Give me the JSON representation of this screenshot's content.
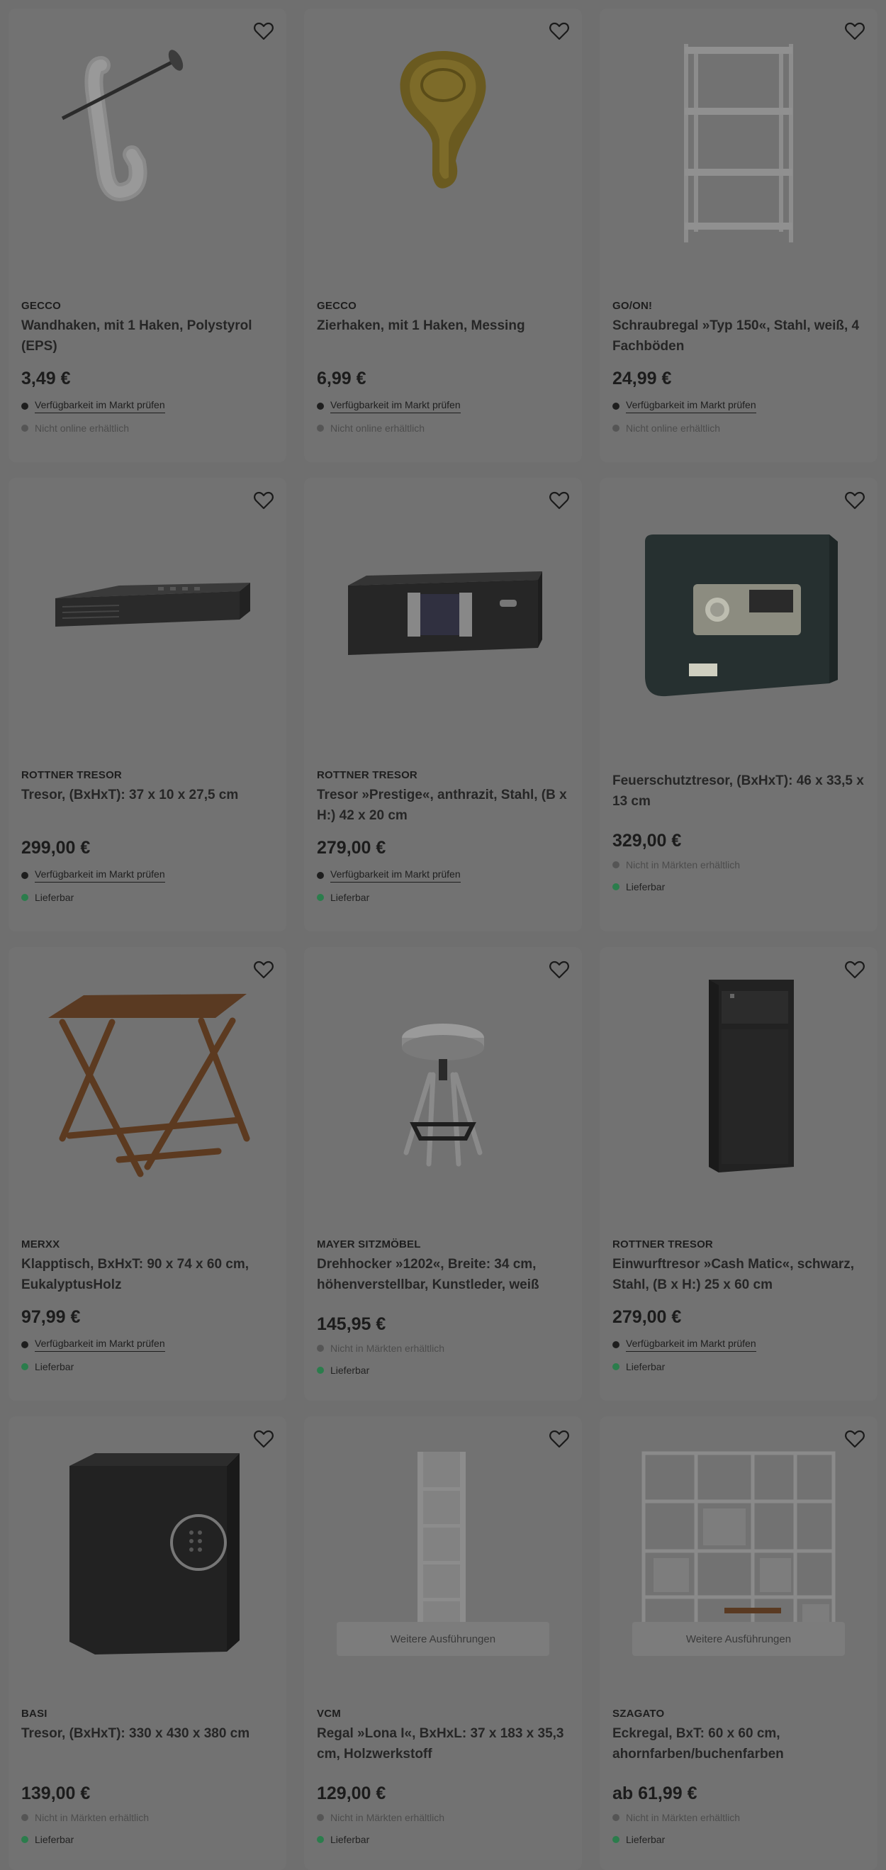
{
  "colors": {
    "page_bg": "#6f6f6f",
    "card_bg": "#727272",
    "dot_store": "#1e1e1e",
    "dot_unavailable": "#555555",
    "dot_deliverable": "#2b7d4c"
  },
  "products": [
    {
      "brand": "GECCO",
      "title": "Wandhaken, mit 1 Haken, Polystyrol (EPS)",
      "price": "3,49 €",
      "image": "clear-wall-hook",
      "store": "Verfügbarkeit im Markt prüfen",
      "store_status": "link",
      "delivery": "Nicht online erhältlich",
      "delivery_status": "unavailable"
    },
    {
      "brand": "GECCO",
      "title": "Zierhaken, mit 1 Haken, Messing",
      "price": "6,99 €",
      "image": "brass-hook",
      "store": "Verfügbarkeit im Markt prüfen",
      "store_status": "link",
      "delivery": "Nicht online erhältlich",
      "delivery_status": "unavailable"
    },
    {
      "brand": "GO/ON!",
      "title": "Schraubregal »Typ 150«, Stahl, weiß, 4 Fachböden",
      "price": "24,99 €",
      "image": "white-steel-shelf",
      "store": "Verfügbarkeit im Markt prüfen",
      "store_status": "link",
      "delivery": "Nicht online erhältlich",
      "delivery_status": "unavailable"
    },
    {
      "brand": "ROTTNER TRESOR",
      "title": "Tresor, (BxHxT): 37 x 10 x 27,5 cm",
      "price": "299,00 €",
      "image": "flat-safe",
      "store": "Verfügbarkeit im Markt prüfen",
      "store_status": "link",
      "delivery": "Lieferbar",
      "delivery_status": "deliverable"
    },
    {
      "brand": "ROTTNER TRESOR",
      "title": "Tresor »Prestige«, anthrazit, Stahl, (B x H:) 42 x 20 cm",
      "price": "279,00 €",
      "image": "anthracite-safe",
      "store": "Verfügbarkeit im Markt prüfen",
      "store_status": "link",
      "delivery": "Lieferbar",
      "delivery_status": "deliverable"
    },
    {
      "brand": "",
      "title": "Feuerschutztresor, (BxHxT): 46 x 33,5 x 13 cm",
      "price": "329,00 €",
      "image": "fire-safe",
      "store": "Nicht in Märkten erhältlich",
      "store_status": "unavailable",
      "delivery": "Lieferbar",
      "delivery_status": "deliverable"
    },
    {
      "brand": "MERXX",
      "title": "Klapptisch, BxHxT: 90 x 74 x 60 cm, EukalyptusHolz",
      "price": "97,99 €",
      "image": "folding-table",
      "store": "Verfügbarkeit im Markt prüfen",
      "store_status": "link",
      "delivery": "Lieferbar",
      "delivery_status": "deliverable"
    },
    {
      "brand": "MAYER SITZMÖBEL",
      "title": "Drehhocker »1202«, Breite: 34 cm, höhenverstellbar, Kunstleder, weiß",
      "price": "145,95 €",
      "image": "swivel-stool",
      "store": "Nicht in Märkten erhältlich",
      "store_status": "unavailable",
      "delivery": "Lieferbar",
      "delivery_status": "deliverable"
    },
    {
      "brand": "ROTTNER TRESOR",
      "title": "Einwurftresor »Cash Matic«, schwarz, Stahl, (B x H:) 25 x 60 cm",
      "price": "279,00 €",
      "image": "deposit-safe",
      "store": "Verfügbarkeit im Markt prüfen",
      "store_status": "link",
      "delivery": "Lieferbar",
      "delivery_status": "deliverable"
    },
    {
      "brand": "BASI",
      "title": "Tresor, (BxHxT): 330 x 430 x 380 cm",
      "price": "139,00 €",
      "image": "black-cube-safe",
      "store": "Nicht in Märkten erhältlich",
      "store_status": "unavailable",
      "delivery": "Lieferbar",
      "delivery_status": "deliverable"
    },
    {
      "brand": "VCM",
      "title": "Regal »Lona I«, BxHxL: 37 x 183 x 35,3 cm, Holzwerkstoff",
      "price": "129,00 €",
      "image": "tall-narrow-shelf",
      "variants": "Weitere Ausführungen",
      "store": "Nicht in Märkten erhältlich",
      "store_status": "unavailable",
      "delivery": "Lieferbar",
      "delivery_status": "deliverable"
    },
    {
      "brand": "SZAGATO",
      "title": "Eckregal, BxT: 60 x 60 cm, ahornfarben/buchenfarben",
      "price": "ab 61,99 €",
      "image": "corner-shelf",
      "variants": "Weitere Ausführungen",
      "store": "Nicht in Märkten erhältlich",
      "store_status": "unavailable",
      "delivery": "Lieferbar",
      "delivery_status": "deliverable"
    }
  ]
}
